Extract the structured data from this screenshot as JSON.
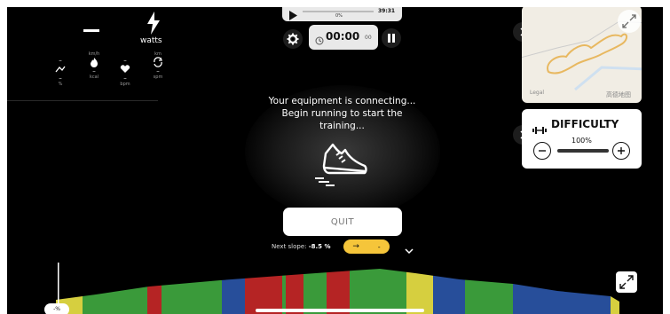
{
  "power": {
    "value": "—",
    "unit": "watts"
  },
  "metrics": [
    {
      "value": "–",
      "unit": "km/h",
      "icon": "speed-icon",
      "sub": "–",
      "subunit": "%"
    },
    {
      "value": "",
      "unit": "",
      "icon": "flame-icon",
      "sub": "–",
      "subunit": "kcal"
    },
    {
      "value": "–",
      "unit": "",
      "icon": "heart-icon",
      "sub": "–",
      "subunit": "bpm"
    },
    {
      "value": "–",
      "unit": "km",
      "icon": "cadence-icon",
      "sub": "–",
      "subunit": "spm"
    }
  ],
  "player": {
    "percent": "0%",
    "time": "39:31",
    "progress": 0
  },
  "timer": {
    "main": "00:00",
    "hundredths": "00"
  },
  "status": {
    "message": "Your equipment is connecting... Begin running to start the training..."
  },
  "quit_label": "QUIT",
  "next_slope": {
    "label": "Next slope:",
    "value": "-8.5 %",
    "arrow": "→",
    "dash": "-"
  },
  "map": {
    "brand_left": "Legal",
    "brand_right": "高德地图"
  },
  "difficulty": {
    "title": "DIFFICULTY",
    "value": "100%",
    "level": 1.0
  },
  "slope_badge": "-%",
  "colors": {
    "green": "#3a9a3a",
    "red": "#b52424",
    "blue": "#274e9a",
    "yellow": "#d6cf3f",
    "accent": "#f5c53a"
  }
}
